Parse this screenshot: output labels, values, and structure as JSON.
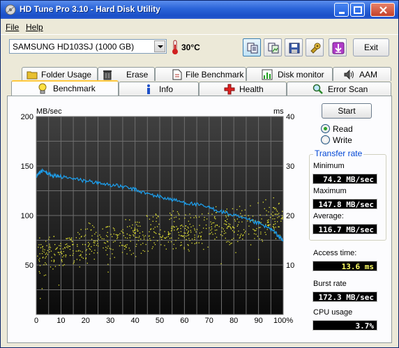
{
  "window": {
    "title": "HD Tune Pro 3.10 - Hard Disk Utility",
    "controls": [
      "minimize",
      "maximize",
      "close"
    ]
  },
  "menu": {
    "file": "File",
    "help": "Help"
  },
  "toolbar": {
    "drive": "SAMSUNG HD103SJ (1000 GB)",
    "temperature": "30°C",
    "exit_label": "Exit",
    "icons": [
      "copy-text-icon",
      "copy-screenshot-icon",
      "save-icon",
      "options-icon",
      "download-icon"
    ]
  },
  "tabs_top": [
    "Folder Usage",
    "Erase",
    "File Benchmark",
    "Disk monitor",
    "AAM"
  ],
  "tabs_bottom": [
    "Benchmark",
    "Info",
    "Health",
    "Error Scan"
  ],
  "active_tab": "Benchmark",
  "controls": {
    "start_label": "Start",
    "read_label": "Read",
    "write_label": "Write",
    "selected_mode": "Read"
  },
  "transfer_rate": {
    "group_title": "Transfer rate",
    "minimum_label": "Minimum",
    "minimum_value": "74.2 MB/sec",
    "maximum_label": "Maximum",
    "maximum_value": "147.8 MB/sec",
    "average_label": "Average:",
    "average_value": "116.7 MB/sec"
  },
  "stats": {
    "access_time_label": "Access time:",
    "access_time_value": "13.6 ms",
    "burst_rate_label": "Burst rate",
    "burst_rate_value": "172.3 MB/sec",
    "cpu_usage_label": "CPU usage",
    "cpu_usage_value": "3.7%"
  },
  "chart_data": {
    "type": "line",
    "y_left_label": "MB/sec",
    "y_right_label": "ms",
    "ylim_left": [
      0,
      200
    ],
    "ylim_right": [
      0,
      40
    ],
    "xlim": [
      0,
      100
    ],
    "y_left_ticks": [
      "200",
      "150",
      "100",
      "50"
    ],
    "y_right_ticks": [
      "40",
      "30",
      "20",
      "10"
    ],
    "x_ticks": [
      "0",
      "10",
      "20",
      "30",
      "40",
      "50",
      "60",
      "70",
      "80",
      "90",
      "100%"
    ],
    "grid": true,
    "series": [
      {
        "name": "Transfer rate",
        "axis": "left",
        "color": "#1e9be6",
        "x": [
          0,
          2,
          4,
          6,
          8,
          10,
          15,
          20,
          25,
          30,
          35,
          40,
          45,
          50,
          55,
          60,
          65,
          70,
          75,
          80,
          85,
          90,
          95,
          98,
          100
        ],
        "y": [
          140,
          145,
          144,
          140,
          140,
          139,
          137,
          135,
          133,
          131,
          129,
          126,
          122,
          119,
          116,
          113,
          111,
          108,
          104,
          100,
          96,
          92,
          86,
          80,
          74
        ]
      },
      {
        "name": "Access time",
        "axis": "right",
        "type": "scatter",
        "color": "#e6e632",
        "trend_x": [
          0,
          10,
          20,
          30,
          40,
          50,
          60,
          70,
          80,
          90,
          100
        ],
        "trend_y": [
          11.5,
          13.0,
          14.5,
          15.5,
          16.0,
          16.5,
          17.0,
          17.5,
          18.0,
          19.0,
          20.0
        ],
        "spread": 4.5
      }
    ]
  }
}
